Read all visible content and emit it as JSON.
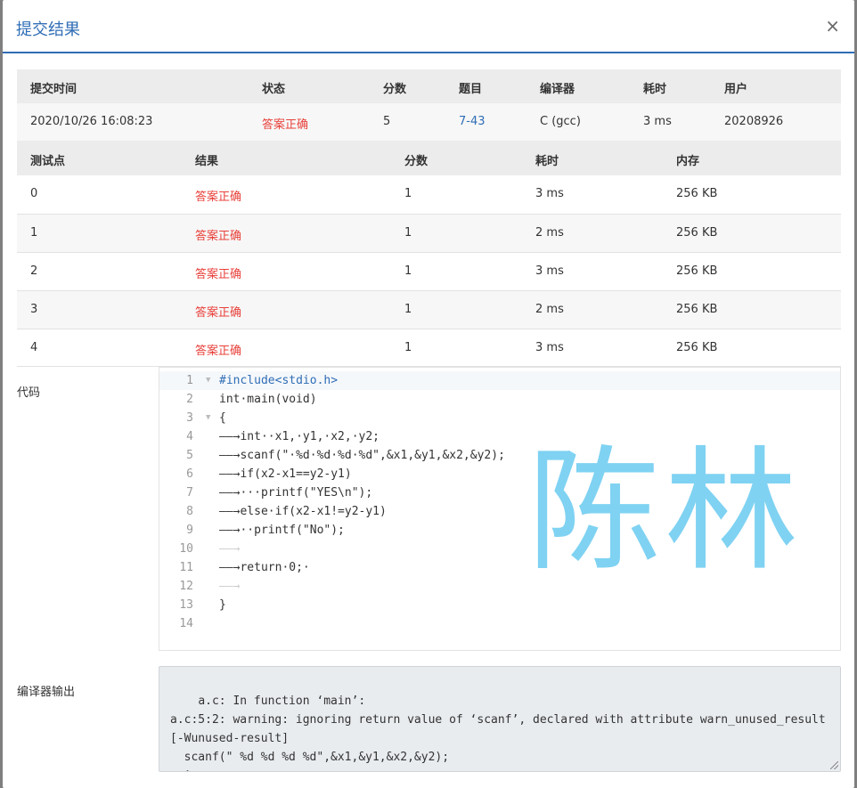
{
  "modal": {
    "title": "提交结果",
    "close_label": "×"
  },
  "summary": {
    "headers": [
      "提交时间",
      "状态",
      "分数",
      "题目",
      "编译器",
      "耗时",
      "用户"
    ],
    "row": [
      "2020/10/26 16:08:23",
      "答案正确",
      "5",
      "7-43",
      "C (gcc)",
      "3 ms",
      "20208926"
    ]
  },
  "tests": {
    "headers": [
      "测试点",
      "结果",
      "分数",
      "耗时",
      "内存"
    ],
    "rows": [
      [
        "0",
        "答案正确",
        "1",
        "3 ms",
        "256 KB"
      ],
      [
        "1",
        "答案正确",
        "1",
        "2 ms",
        "256 KB"
      ],
      [
        "2",
        "答案正确",
        "1",
        "3 ms",
        "256 KB"
      ],
      [
        "3",
        "答案正确",
        "1",
        "2 ms",
        "256 KB"
      ],
      [
        "4",
        "答案正确",
        "1",
        "3 ms",
        "256 KB"
      ]
    ]
  },
  "code_label": "代码",
  "code": {
    "lines": [
      {
        "n": "1",
        "text": "#include<stdio.h>"
      },
      {
        "n": "2",
        "text": "int·main(void)"
      },
      {
        "n": "3",
        "text": "{"
      },
      {
        "n": "4",
        "text": "——→int··x1,·y1,·x2,·y2;"
      },
      {
        "n": "5",
        "text": "——→scanf(\"·%d·%d·%d·%d\",&x1,&y1,&x2,&y2);"
      },
      {
        "n": "6",
        "text": "——→if(x2-x1==y2-y1)"
      },
      {
        "n": "7",
        "text": "——→···printf(\"YES\\n\");"
      },
      {
        "n": "8",
        "text": "——→else·if(x2-x1!=y2-y1)"
      },
      {
        "n": "9",
        "text": "——→··printf(\"No\");"
      },
      {
        "n": "10",
        "text": "——→"
      },
      {
        "n": "11",
        "text": "——→return·0;·"
      },
      {
        "n": "12",
        "text": "——→"
      },
      {
        "n": "13",
        "text": "}"
      },
      {
        "n": "14",
        "text": ""
      }
    ],
    "fold_marker": "▼"
  },
  "watermark": "陈林",
  "compiler_label": "编译器输出",
  "compiler_output": "a.c: In function ‘main’:\na.c:5:2: warning: ignoring return value of ‘scanf’, declared with attribute warn_unused_result [-Wunused-result]\n  scanf(\" %d %d %d %d\",&x1,&y1,&x2,&y2);\n  ^~~~~~~~~~~~~~~~~~~~~~~~~~~~~~~~~~~~~~~~",
  "colors": {
    "accent": "#2f6db5",
    "success": "#e8403a",
    "watermark": "#7fd2f2"
  }
}
